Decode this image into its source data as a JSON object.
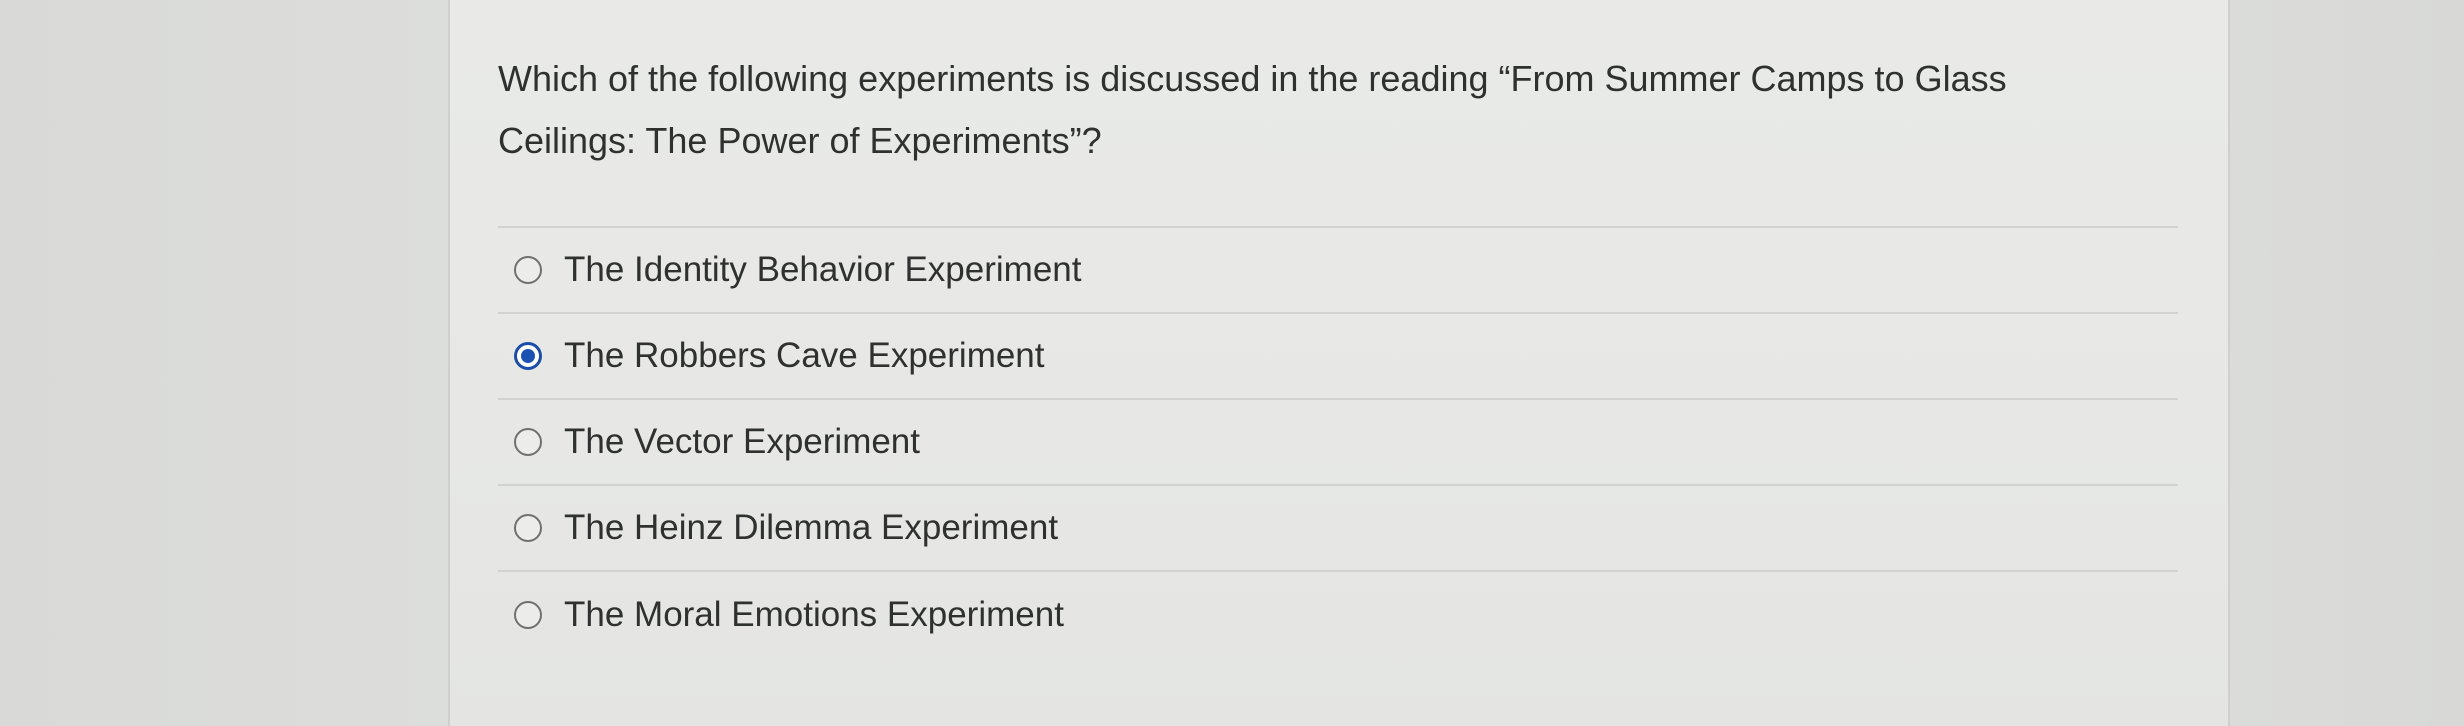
{
  "question": {
    "text": "Which of the following experiments is discussed in the reading “From Summer Camps to Glass Ceilings: The Power of Experiments”?"
  },
  "options": [
    {
      "label": "The Identity Behavior Experiment",
      "selected": false
    },
    {
      "label": "The Robbers Cave Experiment",
      "selected": true
    },
    {
      "label": "The Vector Experiment",
      "selected": false
    },
    {
      "label": "The Heinz Dilemma Experiment",
      "selected": false
    },
    {
      "label": "The Moral Emotions Experiment",
      "selected": false
    }
  ],
  "colors": {
    "selected_radio": "#1d52b5",
    "text": "#2f3030"
  }
}
